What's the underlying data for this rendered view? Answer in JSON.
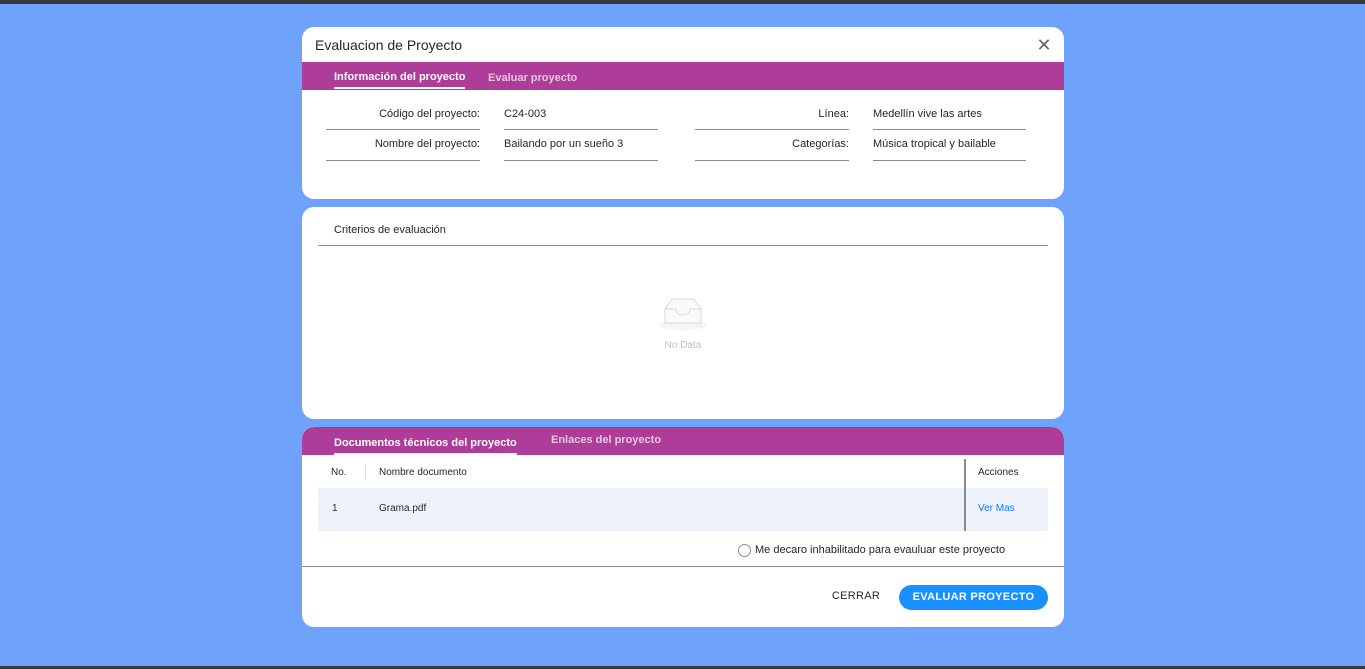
{
  "modal": {
    "title": "Evaluacion de Proyecto"
  },
  "info_tabs": [
    {
      "label": "Información del proyecto",
      "active": true
    },
    {
      "label": "Evaluar proyecto",
      "active": false
    }
  ],
  "info": {
    "codigo_label": "Código del proyecto:",
    "codigo_value": "C24-003",
    "nombre_label": "Nombre del proyecto:",
    "nombre_value": "Bailando por un sueño 3",
    "linea_label": "Línea:",
    "linea_value": "Medellín vive las artes",
    "categorias_label": "Categorías:",
    "categorias_value": "Música tropical y bailable"
  },
  "criterios": {
    "title": "Criterios de evaluación",
    "empty_text": "No Data"
  },
  "doc_tabs": [
    {
      "label": "Documentos técnicos del proyecto",
      "active": true
    },
    {
      "label": "Enlaces del proyecto",
      "active": false
    }
  ],
  "table": {
    "columns": [
      "No.",
      "Nombre documento",
      "Acciones"
    ],
    "rows": [
      {
        "no": "1",
        "nombre": "Grama.pdf",
        "accion": "Ver Mas"
      }
    ]
  },
  "declaration": {
    "label": "Me decaro inhabilitado para evauluar este proyecto",
    "checked": false
  },
  "footer": {
    "cancel_label": "CERRAR",
    "submit_label": "EVALUAR PROYECTO"
  },
  "colors": {
    "background": "#6ea2fb",
    "tab_bar": "#ad3d99",
    "primary": "#1890ff"
  }
}
